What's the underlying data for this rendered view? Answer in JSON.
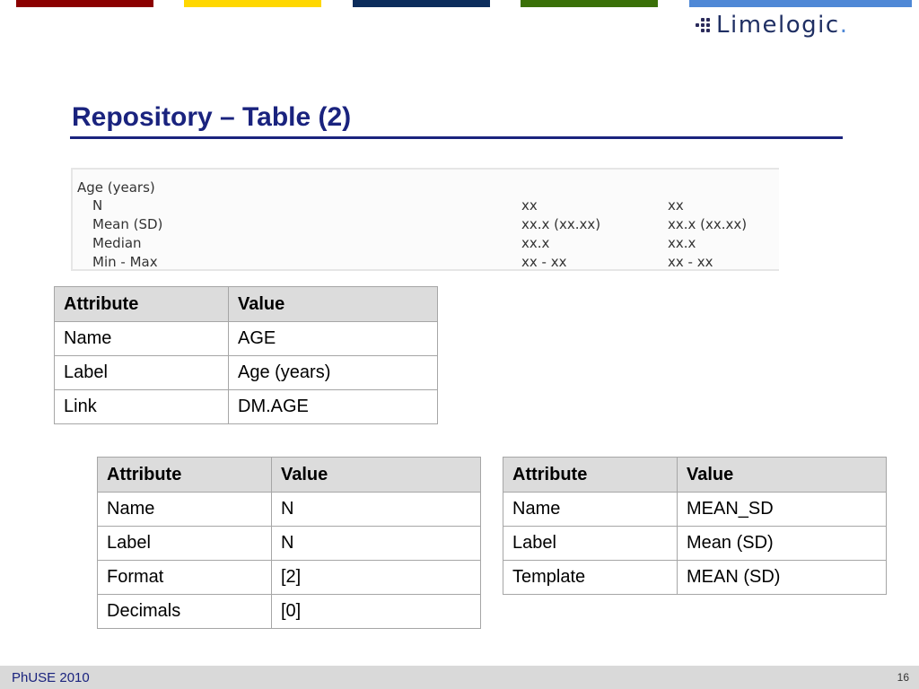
{
  "colors": {
    "bar_red": "#8b0000",
    "bar_yellow": "#ffd700",
    "bar_navy": "#0c2d5c",
    "bar_green": "#3a7008",
    "bar_blue": "#4f88d6",
    "title": "#1a237e",
    "table_header_bg": "#dcdcdc",
    "footer_bg": "#d9d9d9"
  },
  "logo": {
    "text": "Limelogic",
    "dot": "."
  },
  "title": "Repository – Table (2)",
  "preview": {
    "rows": [
      {
        "label": "Age (years)",
        "c1": "",
        "c2": ""
      },
      {
        "label": "  N",
        "c1": "xx",
        "c2": "xx"
      },
      {
        "label": "  Mean (SD)",
        "c1": "xx.x (xx.xx)",
        "c2": "xx.x (xx.xx)"
      },
      {
        "label": "  Median",
        "c1": "xx.x",
        "c2": "xx.x"
      },
      {
        "label": "  Min - Max",
        "c1": "xx - xx",
        "c2": "xx - xx"
      }
    ]
  },
  "table_age": {
    "headers": [
      "Attribute",
      "Value"
    ],
    "rows": [
      [
        "Name",
        "AGE"
      ],
      [
        "Label",
        "Age (years)"
      ],
      [
        "Link",
        "DM.AGE"
      ]
    ]
  },
  "table_n": {
    "headers": [
      "Attribute",
      "Value"
    ],
    "rows": [
      [
        "Name",
        "N"
      ],
      [
        "Label",
        "N"
      ],
      [
        "Format",
        "[2]"
      ],
      [
        "Decimals",
        "[0]"
      ]
    ]
  },
  "table_mean": {
    "headers": [
      "Attribute",
      "Value"
    ],
    "rows": [
      [
        "Name",
        "MEAN_SD"
      ],
      [
        "Label",
        "Mean (SD)"
      ],
      [
        "Template",
        "MEAN (SD)"
      ]
    ]
  },
  "footer": {
    "left": "PhUSE 2010",
    "page": "16"
  }
}
